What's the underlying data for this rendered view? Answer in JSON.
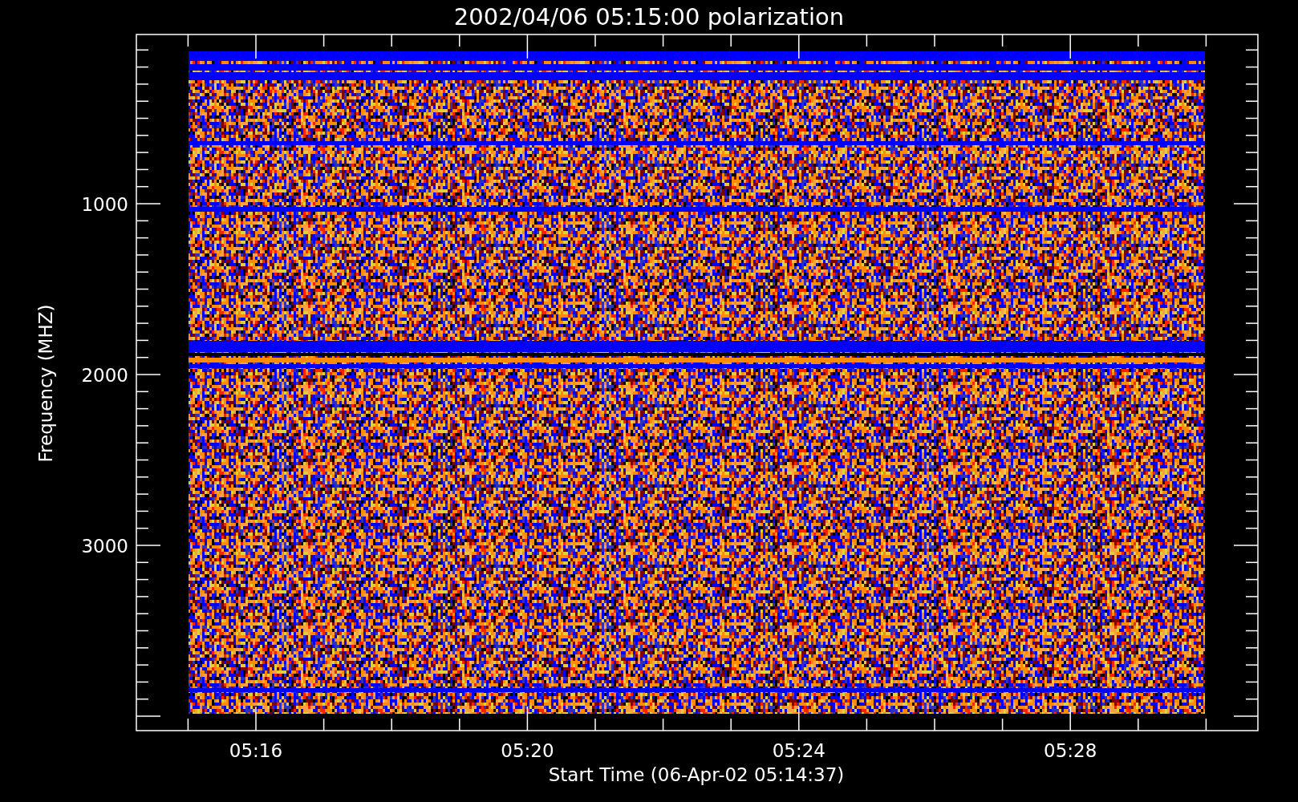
{
  "title": "2002/04/06 05:15:00 polarization",
  "y_axis": {
    "label": "Frequency (MHZ)",
    "ticks": [
      "1000",
      "2000",
      "3000"
    ]
  },
  "x_axis": {
    "label": "Start Time (06-Apr-02 05:14:37)",
    "ticks": [
      "05:16",
      "05:20",
      "05:24",
      "05:28"
    ]
  }
}
